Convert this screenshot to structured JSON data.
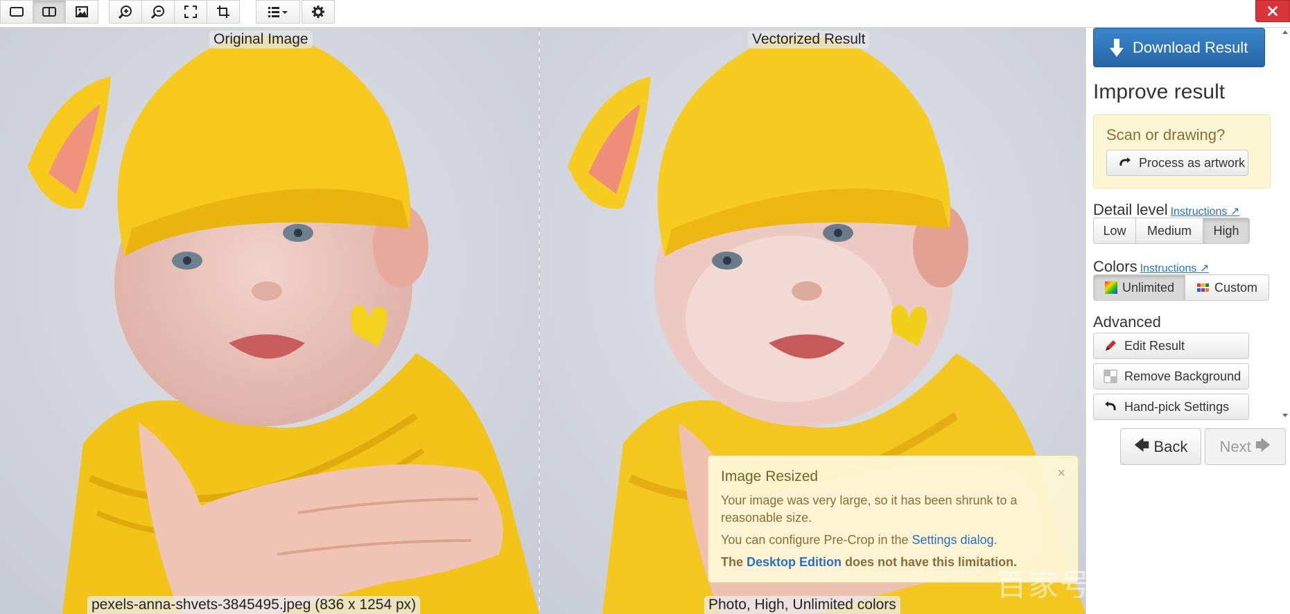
{
  "toolbar": {
    "buttons": [
      {
        "name": "single-view-icon"
      },
      {
        "name": "split-view-icon"
      },
      {
        "name": "image-icon"
      },
      {
        "name": "zoom-in-icon"
      },
      {
        "name": "zoom-out-icon"
      },
      {
        "name": "fit-icon"
      },
      {
        "name": "crop-icon"
      },
      {
        "name": "list-dropdown-icon"
      },
      {
        "name": "gear-icon"
      }
    ],
    "close_icon": "close-icon"
  },
  "left_pane": {
    "label": "Original Image",
    "caption": "pexels-anna-shvets-3845495.jpeg (836 x 1254 px)"
  },
  "right_pane": {
    "label": "Vectorized Result",
    "caption": "Photo, High, Unlimited colors"
  },
  "notice": {
    "title": "Image Resized",
    "close": "×",
    "line1": "Your image was very large, so it has been shrunk to a reasonable size.",
    "line2_prefix": "You can configure Pre-Crop in the ",
    "line2_link": "Settings dialog",
    "line2_suffix": ".",
    "line3_prefix": "The ",
    "line3_link": "Desktop Edition",
    "line3_suffix": " does not have this limitation."
  },
  "watermark": "百家号",
  "sidebar": {
    "download_label": "Download Result",
    "improve_heading": "Improve result",
    "scan_title": "Scan or drawing?",
    "process_artwork_label": "Process as artwork",
    "detail_heading": "Detail level",
    "detail_instructions": "Instructions",
    "detail_options": [
      "Low",
      "Medium",
      "High"
    ],
    "detail_selected": "High",
    "colors_heading": "Colors",
    "colors_instructions": "Instructions",
    "colors_options": [
      "Unlimited",
      "Custom"
    ],
    "colors_selected": "Unlimited",
    "advanced_heading": "Advanced",
    "edit_label": "Edit Result",
    "remove_bg_label": "Remove Background",
    "handpick_label": "Hand-pick Settings",
    "back_label": "Back",
    "next_label": "Next"
  },
  "colors": {
    "primary": "#2f74b8",
    "close": "#d9343a",
    "notice_bg": "#fcf6d4",
    "link": "#2a6fc0"
  }
}
